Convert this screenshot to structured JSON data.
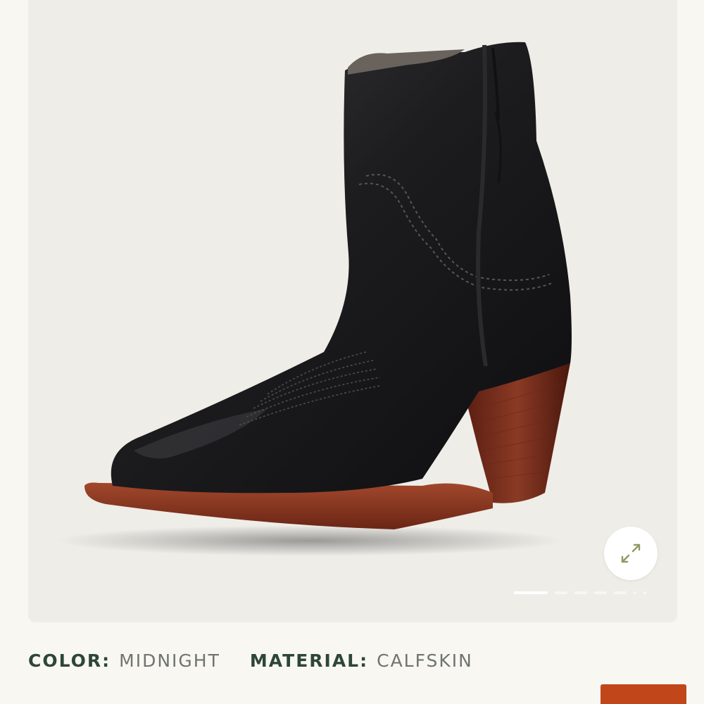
{
  "gallery": {
    "product_image": "black leather western ankle boot with stacked brown heel",
    "expand_icon": "expand-arrows-icon",
    "slides": [
      {
        "active": true
      },
      {
        "active": false
      },
      {
        "active": false
      },
      {
        "active": false
      },
      {
        "active": false
      },
      {
        "active": false
      },
      {
        "active": false
      }
    ]
  },
  "specs": {
    "color_label": "COLOR:",
    "color_value": "MIDNIGHT",
    "material_label": "MATERIAL:",
    "material_value": "CALFSKIN"
  },
  "colors": {
    "background": "#f9f7f2",
    "gallery_bg": "#efede8",
    "label": "#2d4638",
    "value": "#6f7470",
    "accent": "#c1461a",
    "icon": "#8e9a62"
  }
}
